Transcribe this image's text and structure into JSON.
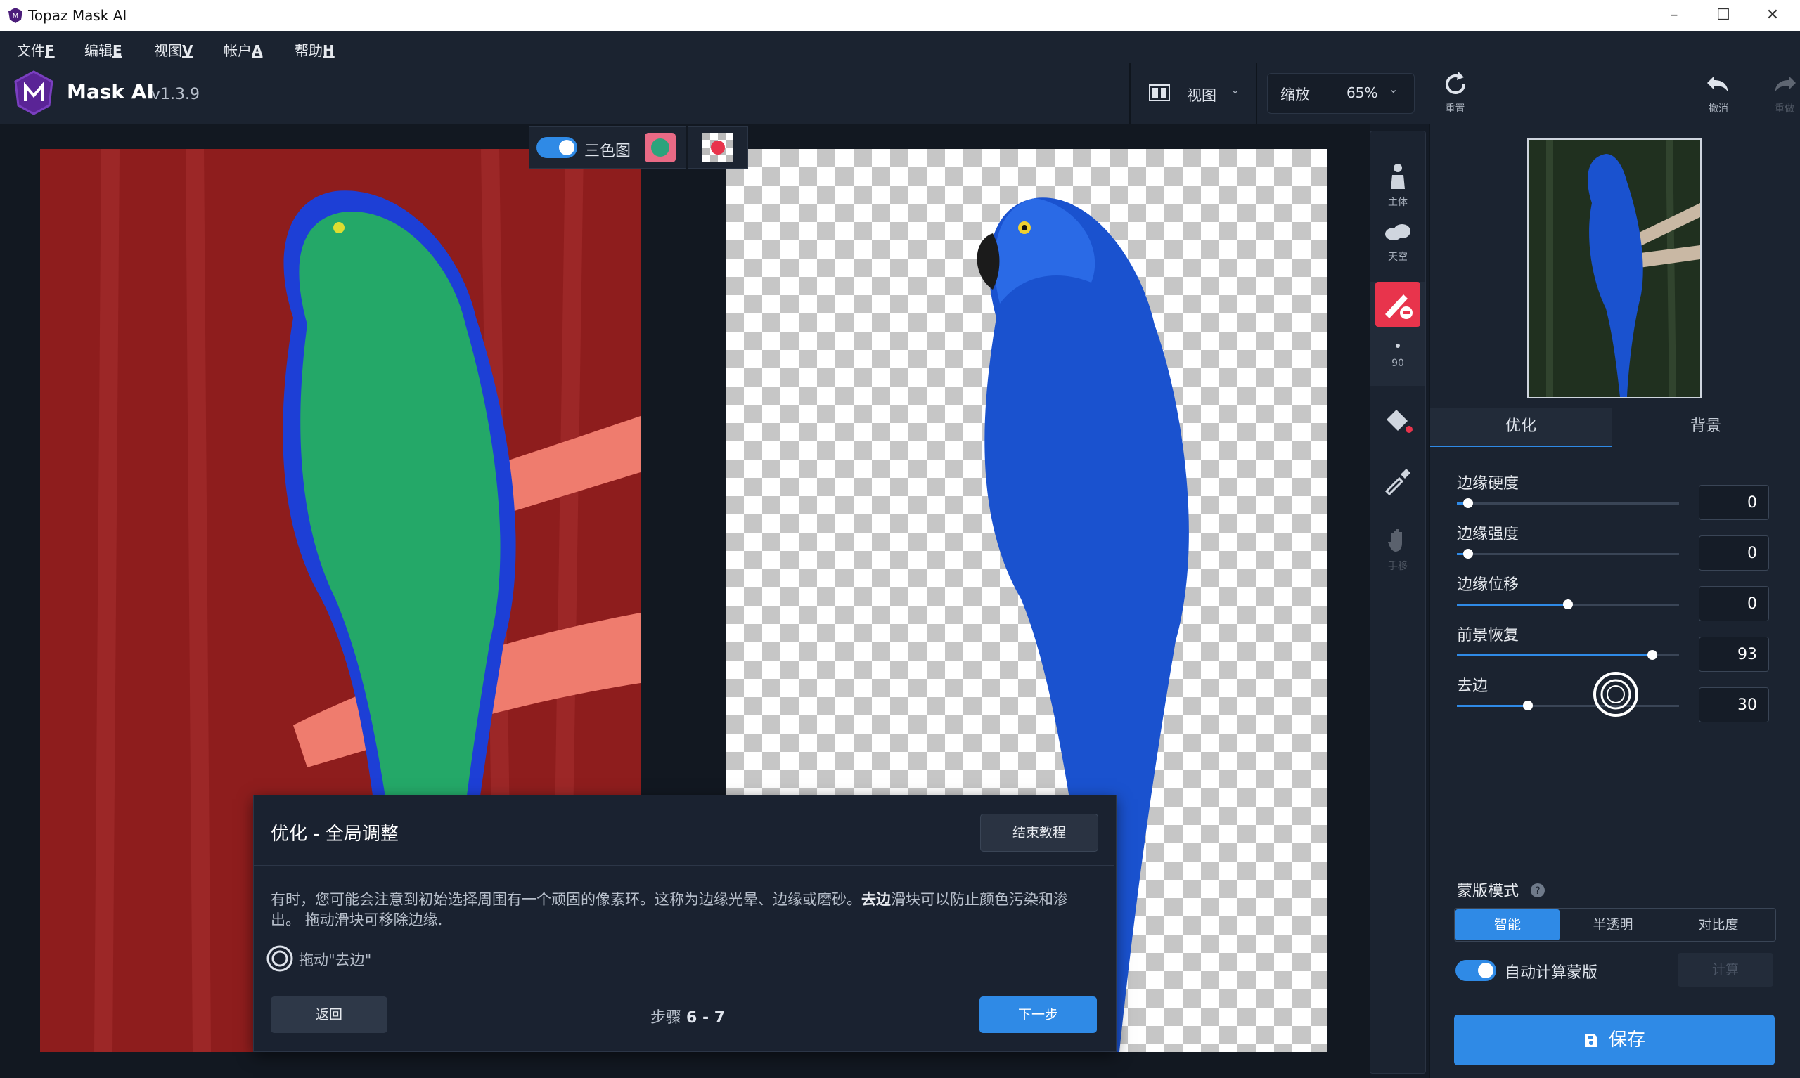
{
  "window": {
    "title": "Topaz Mask AI"
  },
  "menu": {
    "items": [
      {
        "label": "文件",
        "key": "F"
      },
      {
        "label": "编辑",
        "key": "E"
      },
      {
        "label": "视图",
        "key": "V"
      },
      {
        "label": "帐户",
        "key": "A"
      },
      {
        "label": "帮助",
        "key": "H"
      }
    ]
  },
  "header": {
    "app_name": "Mask AI",
    "version": "v1.3.9",
    "view_label": "视图",
    "zoom_label": "缩放",
    "zoom_value": "65%"
  },
  "toolbar_right": {
    "reset": "重置",
    "undo": "撤消",
    "redo": "重做"
  },
  "canvas": {
    "tricolor_label": "三色图"
  },
  "tools": {
    "subject": "主体",
    "sky": "天空",
    "brush_size": "90",
    "hand": "手移"
  },
  "panel": {
    "tabs": [
      "优化",
      "背景"
    ],
    "sliders": [
      {
        "label": "边缘硬度",
        "value": "0",
        "level": 0.05
      },
      {
        "label": "边缘强度",
        "value": "0",
        "level": 0.05
      },
      {
        "label": "边缘位移",
        "value": "0",
        "level": 0.5
      },
      {
        "label": "前景恢复",
        "value": "93",
        "level": 0.88
      },
      {
        "label": "去边",
        "value": "30",
        "level": 0.32
      }
    ],
    "mask_mode_label": "蒙版模式",
    "mask_modes": [
      "智能",
      "半透明",
      "对比度"
    ],
    "auto_label": "自动计算蒙版",
    "compute_label": "计算",
    "save_label": "保存"
  },
  "tutorial": {
    "title": "优化 - 全局调整",
    "end_button": "结束教程",
    "body_pre": "有时，您可能会注意到初始选择周围有一个顽固的像素环。这称为边缘光晕、边缘或磨砂。",
    "body_bold": "去边",
    "body_post": "滑块可以防止颜色污染和渗出。 拖动滑块可移除边缘.",
    "drag_hint": "拖动\"去边\"",
    "back_button": "返回",
    "step_prefix": "步骤",
    "step_value": "6 - 7",
    "next_button": "下一步"
  },
  "colors": {
    "accent": "#2f8ae6",
    "brush_tool": "#e8344c",
    "bg_red": "#8e1d1d"
  }
}
